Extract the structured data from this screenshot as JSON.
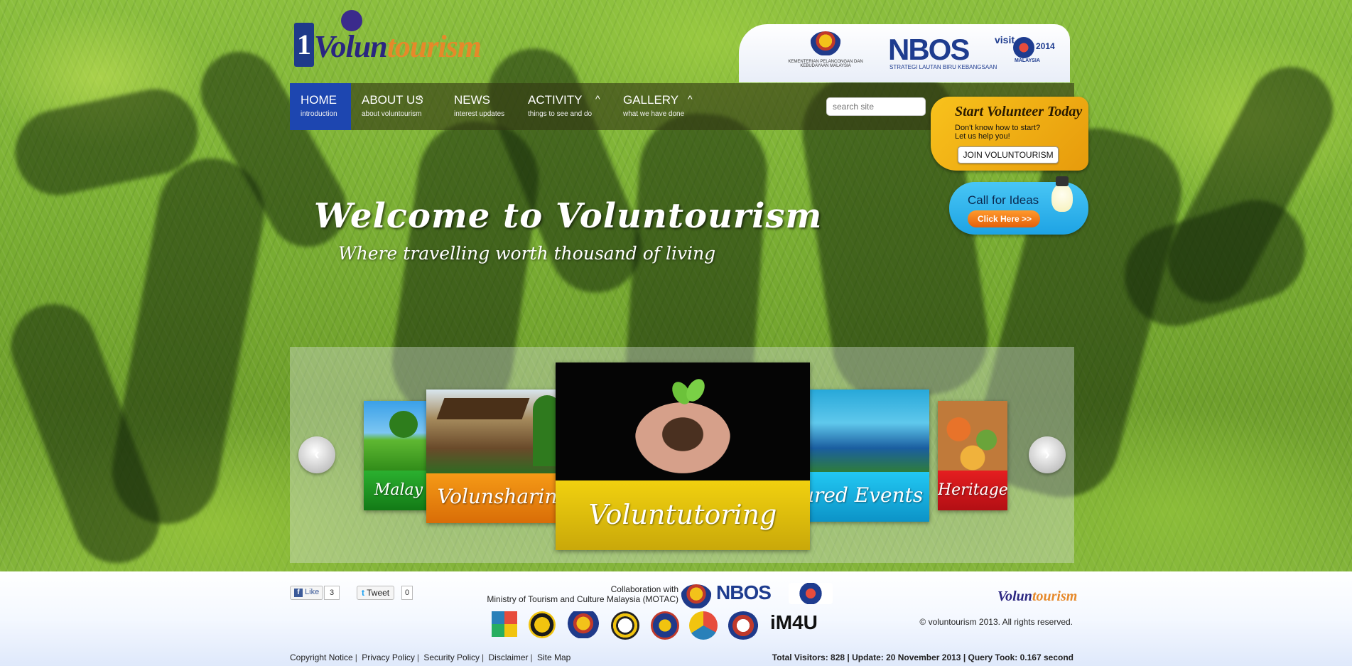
{
  "header": {
    "logo_text_1": "Volun",
    "logo_text_2": "tourism",
    "ministry_caption": "KEMENTERIAN PELANCONGAN DAN KEBUDAYAAN MALAYSIA",
    "nbos_label": "NBOS",
    "nbos_sub": "STRATEGI LAUTAN BIRU KEBANGSAAN",
    "visit_text": "visit",
    "visit_year": "2014",
    "visit_country": "MALAYSIA"
  },
  "nav": {
    "items": [
      {
        "label": "HOME",
        "sub": "introduction",
        "caret": ""
      },
      {
        "label": "ABOUT US",
        "sub": "about voluntourism",
        "caret": "^"
      },
      {
        "label": "NEWS",
        "sub": "interest updates",
        "caret": ""
      },
      {
        "label": "ACTIVITY",
        "sub": "things to see and do",
        "caret": "^"
      },
      {
        "label": "GALLERY",
        "sub": "what we have done",
        "caret": "^"
      }
    ],
    "search_placeholder": "search site"
  },
  "volunteer_card": {
    "title": "Start Volunteer Today",
    "line1": "Don't know how to start?",
    "line2": "Let us help you!",
    "button": "JOIN VOLUNTOURISM"
  },
  "ideas_card": {
    "title": "Call for Ideas",
    "button": "Click Here  >>"
  },
  "hero": {
    "welcome": "Welcome to Voluntourism",
    "tagline": "Where travelling worth thousand of living"
  },
  "carousel": {
    "prev": "‹",
    "next": "›",
    "cards": [
      {
        "caption": "Malay",
        "color": "#1f9a23"
      },
      {
        "caption": "Volunsharin",
        "color": "#ee8c10"
      },
      {
        "caption": "Voluntutoring",
        "color": "#e7c60d"
      },
      {
        "caption": "tured Events",
        "color": "#11b8e7"
      },
      {
        "caption": "Heritage",
        "color": "#d8161b"
      }
    ]
  },
  "footer": {
    "like_label": "Like",
    "like_count": "3",
    "tweet_label": "Tweet",
    "tweet_count": "0",
    "collab_line1": "Collaboration with",
    "collab_line2": "Ministry of Tourism and Culture Malaysia (MOTAC)",
    "nbos_label": "NBOS",
    "im4u_label": "iM4U",
    "logo_text_1": "Volun",
    "logo_text_2": "tourism",
    "copyright": "© voluntourism 2013. All rights reserved.",
    "links": [
      "Copyright Notice",
      "Privacy Policy",
      "Security Policy",
      "Disclaimer",
      "Site Map"
    ],
    "stats": "Total Visitors: 828 | Update: 20 November 2013 | Query Took: 0.167 second"
  }
}
